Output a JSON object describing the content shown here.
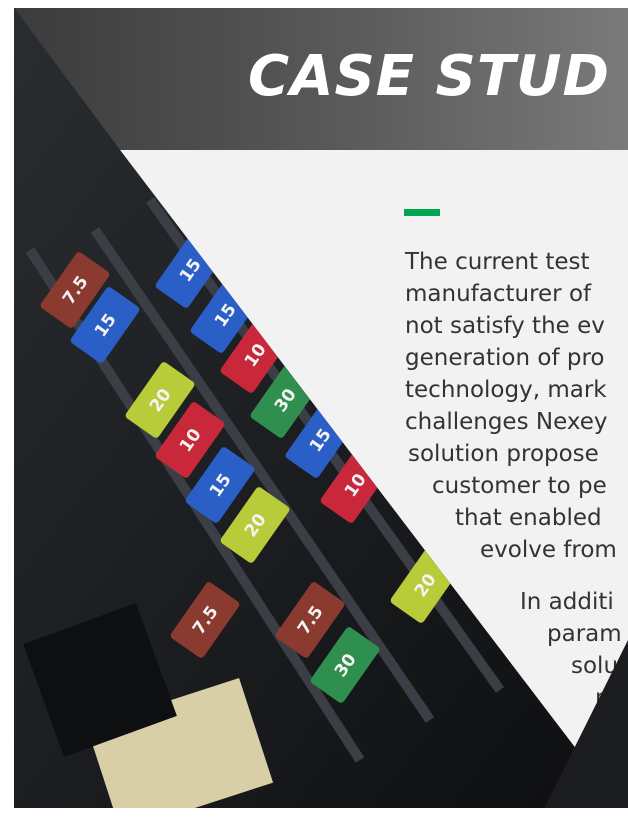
{
  "title": "CASE STUD",
  "accent_color": "#00a650",
  "paragraph_lines": [
    "The current test",
    "manufacturer of",
    "not satisfy the ev",
    "generation of pro",
    "technology, mark",
    "challenges Nexey",
    "solution propose",
    "customer to pe",
    "that enabled",
    "evolve from"
  ],
  "paragraph2_lines": [
    "In additi",
    "param",
    "solut",
    "me"
  ],
  "fuses": [
    {
      "label": "7.5",
      "color": "#8b3a2f"
    },
    {
      "label": "15",
      "color": "#2a5fc8"
    },
    {
      "label": "15",
      "color": "#2a5fc8"
    },
    {
      "label": "15",
      "color": "#2a5fc8"
    },
    {
      "label": "10",
      "color": "#c8283a"
    },
    {
      "label": "20",
      "color": "#b8cc3a"
    },
    {
      "label": "10",
      "color": "#c8283a"
    },
    {
      "label": "30",
      "color": "#2f8f4e"
    },
    {
      "label": "15",
      "color": "#2a5fc8"
    },
    {
      "label": "15",
      "color": "#2a5fc8"
    },
    {
      "label": "20",
      "color": "#b8cc3a"
    },
    {
      "label": "10",
      "color": "#c8283a"
    },
    {
      "label": "7.5",
      "color": "#8b3a2f"
    },
    {
      "label": "7.5",
      "color": "#8b3a2f"
    },
    {
      "label": "30",
      "color": "#2f8f4e"
    },
    {
      "label": "20",
      "color": "#b8cc3a"
    }
  ]
}
